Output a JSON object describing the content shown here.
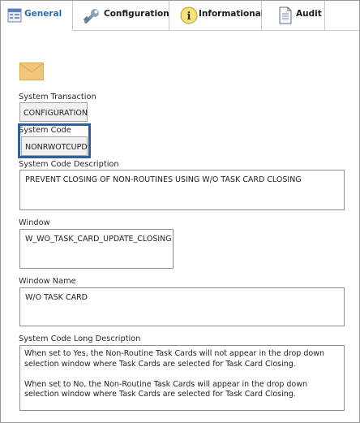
{
  "tabs": [
    {
      "label": "General",
      "icon": "grid-icon",
      "active": true
    },
    {
      "label": "Configuration",
      "icon": "wrench-icon",
      "active": false
    },
    {
      "label": "Informational",
      "icon": "info-icon",
      "active": false
    },
    {
      "label": "Audit",
      "icon": "document-icon",
      "active": false
    }
  ],
  "header_icon": "envelope-icon",
  "fields": {
    "system_transaction": {
      "label": "System Transaction",
      "value": "CONFIGURATION"
    },
    "system_code": {
      "label": "System Code",
      "value": "NONRWOTCUPD"
    },
    "system_code_description": {
      "label": "System Code Description",
      "value": "PREVENT CLOSING OF NON-ROUTINES USING W/O TASK CARD CLOSING"
    },
    "window": {
      "label": "Window",
      "value": "W_WO_TASK_CARD_UPDATE_CLOSING"
    },
    "window_name": {
      "label": "Window Name",
      "value": "W/O TASK CARD"
    },
    "long_description": {
      "label": "System Code Long Description",
      "value": "When set to Yes, the Non-Routine Task Cards will not appear in the drop down selection window where Task Cards are selected for Task Card Closing.\n\nWhen set to No, the Non-Routine Task Cards will appear in the drop down selection window where Task Cards are selected for Task Card Closing."
    }
  },
  "colors": {
    "active_tab_text": "#2a6db0",
    "highlight_border": "#2e5f9e",
    "envelope": "#f2c77a"
  }
}
